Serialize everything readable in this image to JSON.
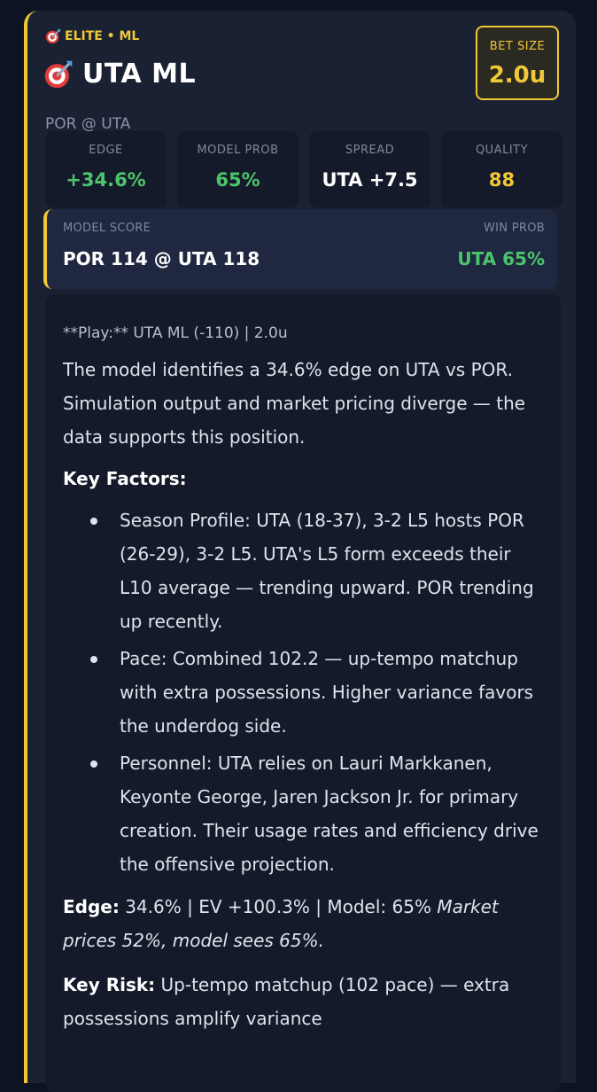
{
  "header": {
    "badge": "ELITE • ML",
    "title": "UTA ML",
    "matchup": "POR @ UTA"
  },
  "bet_size": {
    "label": "BET SIZE",
    "value": "2.0u"
  },
  "stats": [
    {
      "label": "EDGE",
      "value": "+34.6%",
      "color": "#4cc46c"
    },
    {
      "label": "MODEL PROB",
      "value": "65%",
      "color": "#4cc46c"
    },
    {
      "label": "SPREAD",
      "value": "UTA +7.5",
      "color": "#ffffff"
    },
    {
      "label": "QUALITY",
      "value": "88",
      "color": "#f0c836"
    }
  ],
  "score": {
    "model_label": "MODEL SCORE",
    "model_value": "POR 114 @ UTA 118",
    "win_label": "WIN PROB",
    "win_value": "UTA 65%"
  },
  "analysis": {
    "play_line": "**Play:** UTA ML (-110) | 2.0u",
    "summary": "The model identifies a 34.6% edge on UTA vs POR. Simulation output and market pricing diverge — the data supports this position.",
    "key_factors_heading": "Key Factors:",
    "factors": [
      "Season Profile: UTA (18-37), 3-2 L5 hosts POR (26-29), 3-2 L5. UTA's L5 form exceeds their L10 average — trending upward. POR trending up recently.",
      "Pace: Combined 102.2 — up-tempo matchup with extra possessions. Higher variance favors the underdog side.",
      "Personnel: UTA relies on Lauri Markkanen, Keyonte George, Jaren Jackson Jr. for primary creation. Their usage rates and efficiency drive the offensive projection."
    ],
    "edge_label": "Edge:",
    "edge_text": "34.6% | EV +100.3% | Model: 65%",
    "edge_italic": "Market prices 52%, model sees 65%.",
    "risk_label": "Key Risk:",
    "risk_text": "Up-tempo matchup (102 pace) — extra possessions amplify variance"
  },
  "colors": {
    "accent": "#f0c836",
    "positive": "#4cc46c",
    "background": "#0e1323",
    "card": "#1a2132"
  }
}
